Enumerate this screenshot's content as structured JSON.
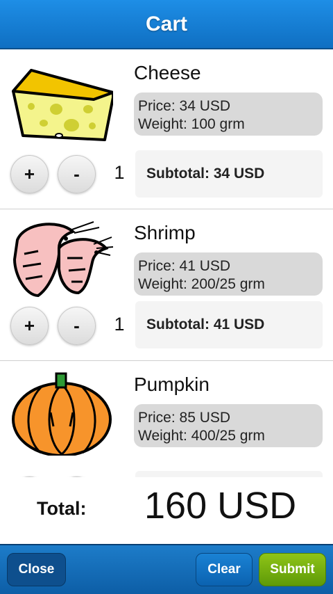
{
  "header": {
    "title": "Cart"
  },
  "items": [
    {
      "name": "Cheese",
      "price": "Price: 34 USD",
      "weight": "Weight: 100 grm",
      "plus": "+",
      "minus": "-",
      "quantity": "1",
      "subtotal": "Subtotal: 34 USD",
      "icon": "cheese-icon"
    },
    {
      "name": "Shrimp",
      "price": "Price: 41 USD",
      "weight": "Weight: 200/25 grm",
      "plus": "+",
      "minus": "-",
      "quantity": "1",
      "subtotal": "Subtotal: 41 USD",
      "icon": "shrimp-icon"
    },
    {
      "name": "Pumpkin",
      "price": "Price: 85 USD",
      "weight": "Weight: 400/25 grm",
      "icon": "pumpkin-icon"
    }
  ],
  "total": {
    "label": "Total:",
    "value": "160 USD"
  },
  "footer": {
    "close": "Close",
    "clear": "Clear",
    "submit": "Submit"
  },
  "colors": {
    "header": "#1e8ee6",
    "submit": "#7db312",
    "info_bg": "#d9d9d9"
  }
}
